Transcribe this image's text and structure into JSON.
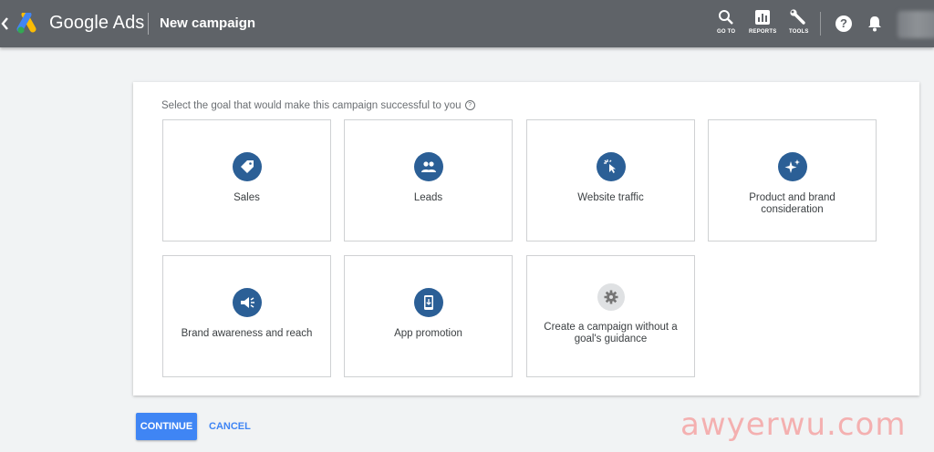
{
  "header": {
    "brand": "Google Ads",
    "title": "New campaign",
    "tools": [
      {
        "label": "GO TO",
        "icon": "search-icon"
      },
      {
        "label": "REPORTS",
        "icon": "reports-icon"
      },
      {
        "label": "TOOLS",
        "icon": "wrench-icon"
      }
    ],
    "help_glyph": "?"
  },
  "main": {
    "prompt": "Select the goal that would make this campaign successful to you",
    "help_glyph": "?",
    "goals": [
      {
        "label": "Sales",
        "icon": "price-tag-icon"
      },
      {
        "label": "Leads",
        "icon": "people-icon"
      },
      {
        "label": "Website traffic",
        "icon": "cursor-click-icon"
      },
      {
        "label": "Product and brand consideration",
        "icon": "sparkle-icon"
      },
      {
        "label": "Brand awareness and reach",
        "icon": "megaphone-icon"
      },
      {
        "label": "App promotion",
        "icon": "phone-download-icon"
      },
      {
        "label": "Create a campaign without a goal's guidance",
        "icon": "gear-icon"
      }
    ]
  },
  "actions": {
    "continue": "CONTINUE",
    "cancel": "CANCEL"
  },
  "watermark": "awyerwu.com",
  "colors": {
    "topbar": "#5f6368",
    "goal_icon_bg": "#2b5f96",
    "primary": "#3f85f4"
  }
}
